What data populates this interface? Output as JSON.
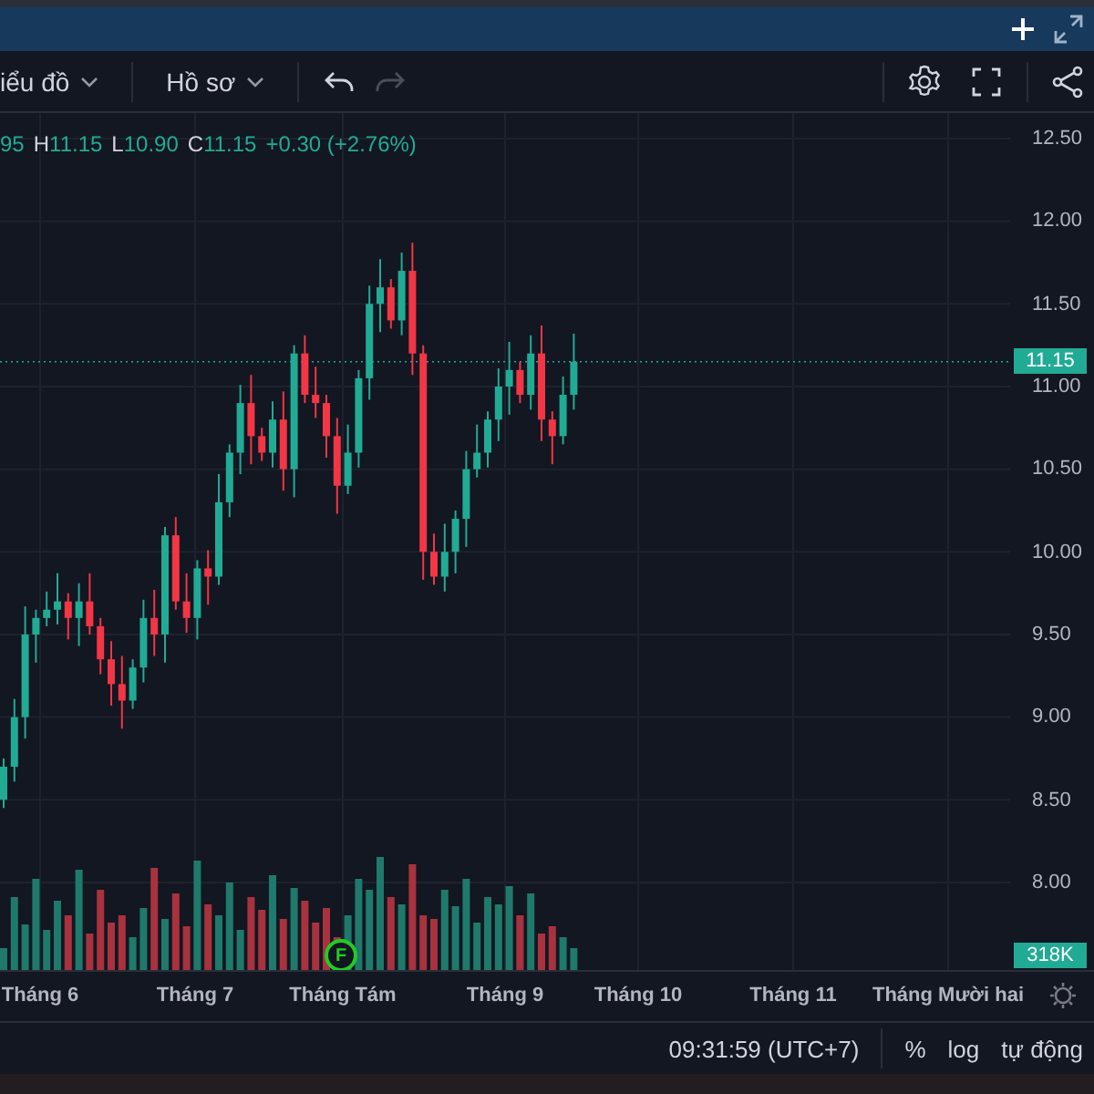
{
  "toolbar": {
    "menus": [
      {
        "label": "iểu đồ"
      },
      {
        "label": "Hồ sơ"
      }
    ],
    "history": [
      {
        "kind": "undo",
        "disabled": false
      },
      {
        "kind": "redo",
        "disabled": true
      }
    ]
  },
  "legend": [
    {
      "value": "95"
    },
    {
      "key": "H",
      "value": "11.15"
    },
    {
      "key": "L",
      "value": "10.90"
    },
    {
      "key": "C",
      "value": "11.15"
    },
    {
      "value": "+0.30 (+2.76%)"
    }
  ],
  "price_axis": {
    "ticks": [
      "12.50",
      "12.00",
      "11.50",
      "11.00",
      "10.50",
      "10.00",
      "9.50",
      "9.00",
      "8.50",
      "8.00"
    ],
    "last_price": "11.15",
    "volume": "318K"
  },
  "event_marker": "F",
  "time_axis": [
    "Tháng 6",
    "Tháng 7",
    "Tháng Tám",
    "Tháng 9",
    "Tháng 10",
    "Tháng 11",
    "Tháng Mười hai"
  ],
  "status_bar": {
    "time": "09:31:59 (UTC+7)",
    "options": [
      "%",
      "log",
      "tự động"
    ]
  }
}
